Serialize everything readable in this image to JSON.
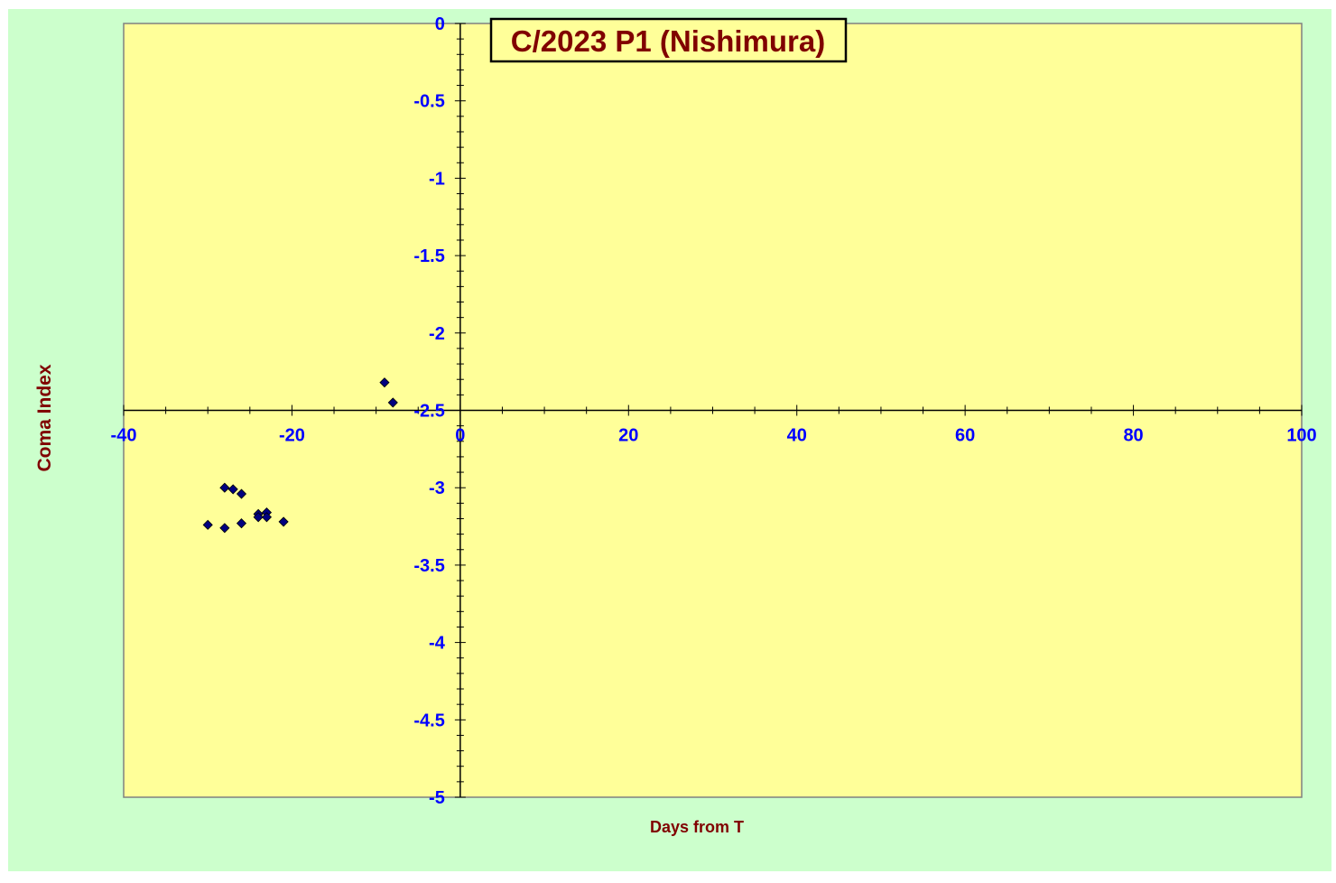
{
  "chart_data": {
    "type": "scatter",
    "title": "C/2023 P1 (Nishimura)",
    "xlabel": "Days from T",
    "ylabel": "Coma Index",
    "xlim": [
      -40,
      100
    ],
    "ylim": [
      -5,
      0
    ],
    "x_ticks": [
      -40,
      -20,
      0,
      20,
      40,
      60,
      80,
      100
    ],
    "y_ticks": [
      0,
      -0.5,
      -1,
      -1.5,
      -2,
      -2.5,
      -3,
      -3.5,
      -4,
      -4.5,
      -5
    ],
    "x_tick_labels": [
      "-40",
      "-20",
      "0",
      "20",
      "40",
      "60",
      "80",
      "100"
    ],
    "y_tick_labels": [
      "0",
      "-0.5",
      "-1",
      "-1.5",
      "-2",
      "-2.5",
      "-3",
      "-3.5",
      "-4",
      "-4.5",
      "-5"
    ],
    "grid": false,
    "legend": "none",
    "series": [
      {
        "x": [
          -9,
          -8,
          -28,
          -27,
          -26,
          -30,
          -28,
          -26,
          -24,
          -24,
          -23,
          -23,
          -21
        ],
        "y": [
          -2.32,
          -2.45,
          -3.0,
          -3.01,
          -3.04,
          -3.24,
          -3.26,
          -3.23,
          -3.17,
          -3.19,
          -3.16,
          -3.19,
          -3.22
        ]
      }
    ],
    "colors": {
      "figure_background": "#ccffcc",
      "plot_background": "#ffff99",
      "marker": "#000080",
      "axis_numbers": "#0000ff",
      "titles": "#800000"
    }
  }
}
